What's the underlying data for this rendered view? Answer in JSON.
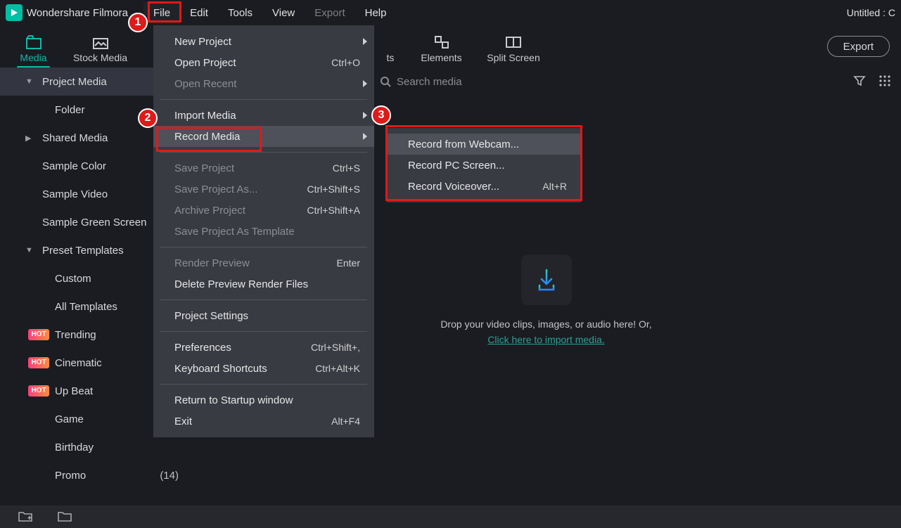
{
  "app": {
    "name": "Wondershare Filmora",
    "title_right": "Untitled : C"
  },
  "menubar": {
    "file": "File",
    "edit": "Edit",
    "tools": "Tools",
    "view": "View",
    "export": "Export",
    "help": "Help"
  },
  "modules": {
    "media": "Media",
    "stock": "Stock Media",
    "effects_tail": "ts",
    "elements": "Elements",
    "split": "Split Screen",
    "export": "Export"
  },
  "sidebar": {
    "project_media": "Project Media",
    "folder": "Folder",
    "shared_media": "Shared Media",
    "sample_color": "Sample Color",
    "sample_video": "Sample Video",
    "sample_green": "Sample Green Screen",
    "preset_templates": "Preset Templates",
    "custom": "Custom",
    "all_templates": "All Templates",
    "trending": "Trending",
    "cinematic": "Cinematic",
    "up_beat": "Up Beat",
    "game": "Game",
    "birthday": "Birthday",
    "promo": "Promo",
    "promo_count": "(14)",
    "hot": "HOT"
  },
  "search": {
    "placeholder": "Search media"
  },
  "drop": {
    "line1": "Drop your video clips, images, or audio here! Or,",
    "link": "Click here to import media."
  },
  "file_menu": {
    "new_project": "New Project",
    "open_project": "Open Project",
    "open_project_sc": "Ctrl+O",
    "open_recent": "Open Recent",
    "import_media": "Import Media",
    "record_media": "Record Media",
    "save_project": "Save Project",
    "save_project_sc": "Ctrl+S",
    "save_project_as": "Save Project As...",
    "save_project_as_sc": "Ctrl+Shift+S",
    "archive_project": "Archive Project",
    "archive_project_sc": "Ctrl+Shift+A",
    "save_template": "Save Project As Template",
    "render_preview": "Render Preview",
    "render_preview_sc": "Enter",
    "delete_preview": "Delete Preview Render Files",
    "project_settings": "Project Settings",
    "preferences": "Preferences",
    "preferences_sc": "Ctrl+Shift+,",
    "keyboard": "Keyboard Shortcuts",
    "keyboard_sc": "Ctrl+Alt+K",
    "startup": "Return to Startup window",
    "exit": "Exit",
    "exit_sc": "Alt+F4"
  },
  "record_menu": {
    "webcam": "Record from Webcam...",
    "screen": "Record PC Screen...",
    "voice": "Record Voiceover...",
    "voice_sc": "Alt+R"
  },
  "annotations": {
    "n1": "1",
    "n2": "2",
    "n3": "3"
  }
}
